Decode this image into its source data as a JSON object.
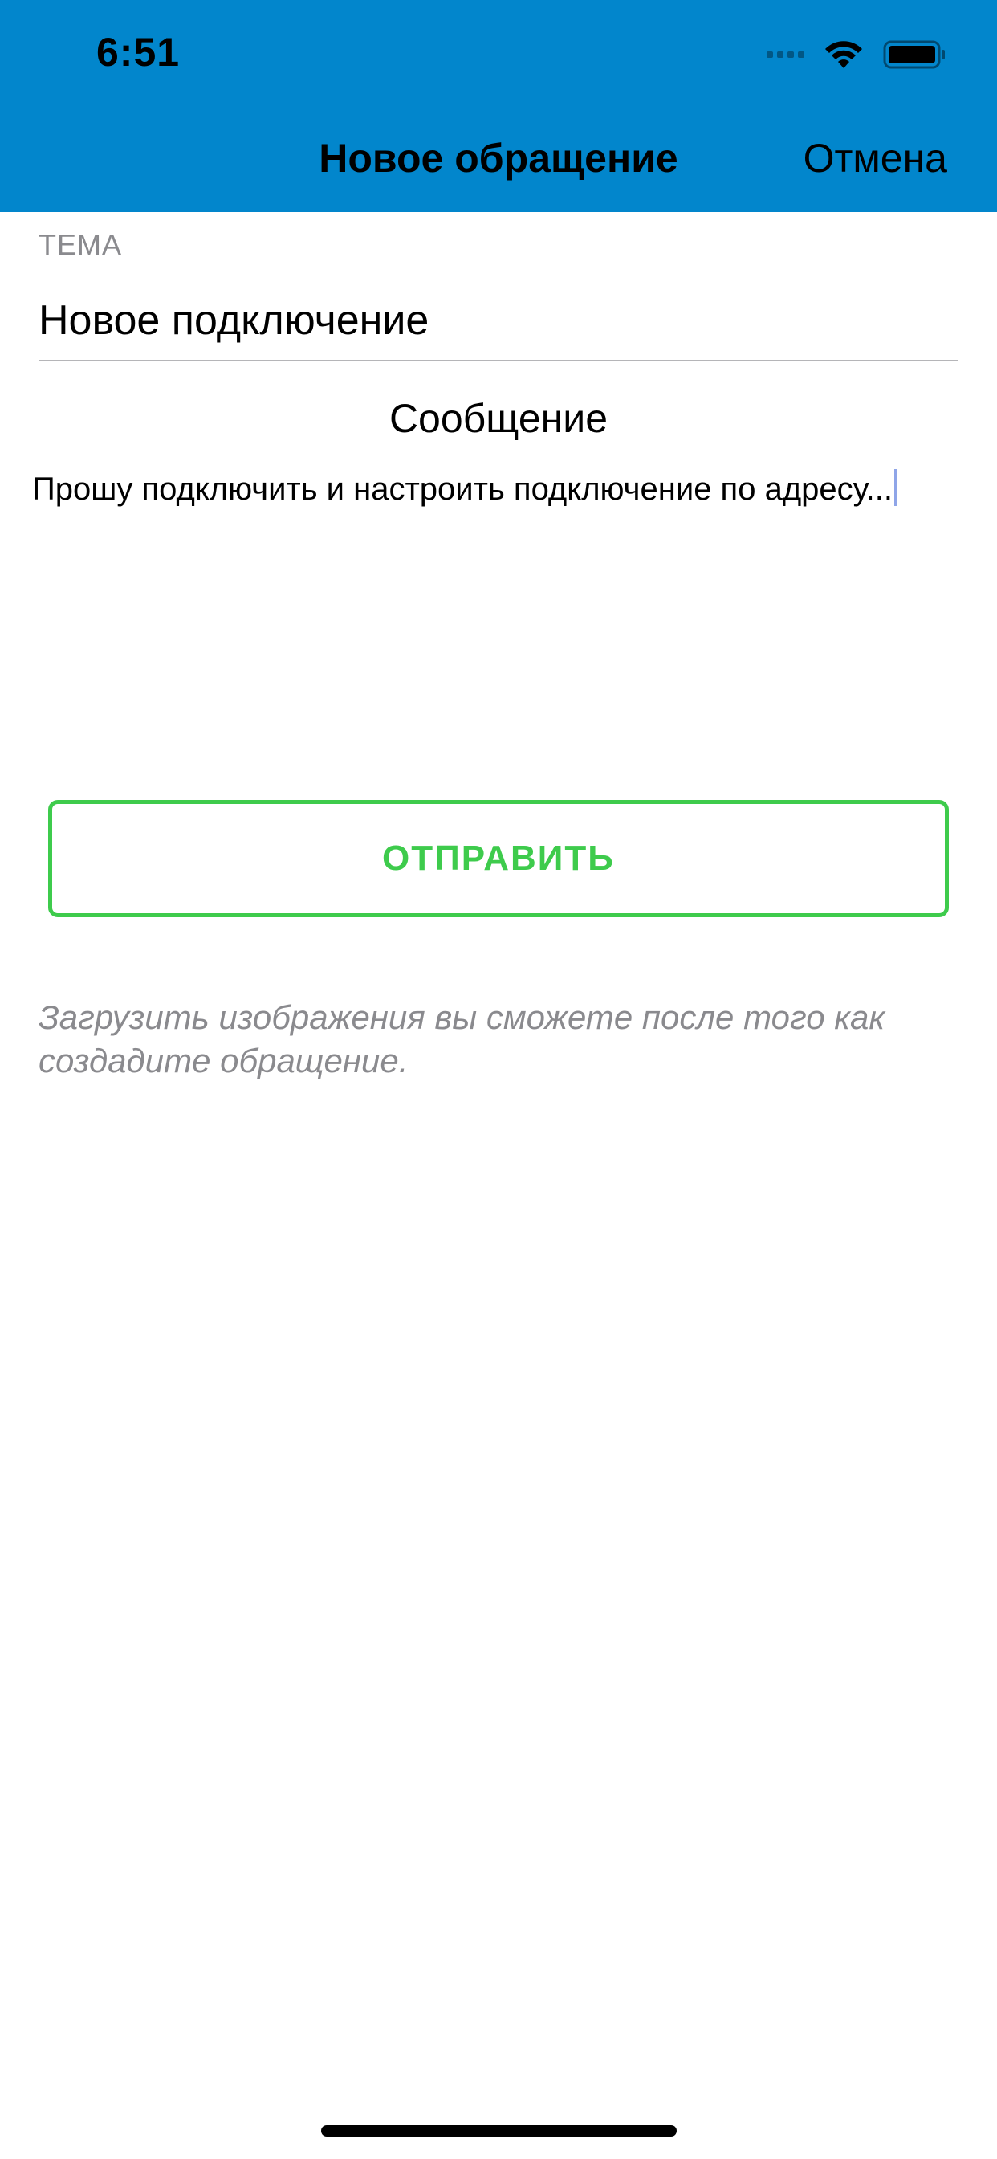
{
  "status_bar": {
    "time": "6:51",
    "icons": [
      "signal-icon",
      "wifi-icon",
      "battery-icon"
    ]
  },
  "nav": {
    "title": "Новое обращение",
    "cancel_label": "Отмена",
    "background_color": "#0286CC"
  },
  "form": {
    "subject_label": "ТЕМА",
    "subject_value": "Новое подключение",
    "message_label": "Сообщение",
    "message_value": "Прошу подключить и настроить подключение по адресу..."
  },
  "actions": {
    "send_label": "ОТПРАВИТЬ",
    "send_color": "#3ECB4C"
  },
  "hint": "Загрузить изображения вы сможете после того как создадите обращение."
}
